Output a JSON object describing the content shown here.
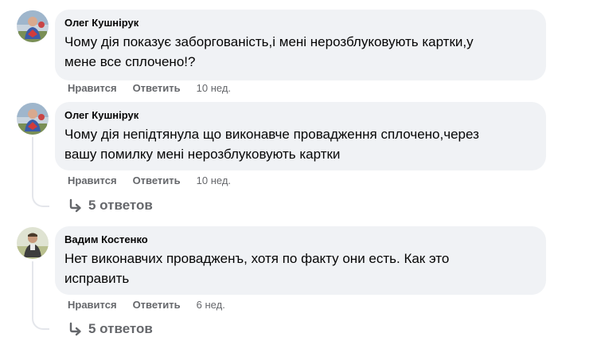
{
  "comments": [
    {
      "author": "Олег Кушнірук",
      "text_line1": "Чому дія показує заборгованість,і мені нерозблуковують картки,у",
      "text_line2": "мене все сплочено!?",
      "like": "Нравится",
      "reply": "Ответить",
      "time": "10 нед."
    },
    {
      "author": "Олег Кушнірук",
      "text_line1": "Чому дія непідтянула що виконавче провадження сплочено,через",
      "text_line2": "вашу помилку мені нерозблуковують картки",
      "like": "Нравится",
      "reply": "Ответить",
      "time": "10 нед.",
      "replies": "5 ответов"
    },
    {
      "author": "Вадим Костенко",
      "text_line1": "Нет виконавчих провадженъ, хотя по факту они есть. Как это",
      "text_line2": "исправить",
      "like": "Нравится",
      "reply": "Ответить",
      "time": "6 нед.",
      "replies": "5 ответов"
    }
  ],
  "icons": {
    "avatar": "user-avatar",
    "replies_arrow": "reply-arrow-icon"
  },
  "colors": {
    "bubble": "#f0f2f5",
    "text": "#050505",
    "secondary": "#65676b",
    "thread": "#e4e6eb"
  }
}
